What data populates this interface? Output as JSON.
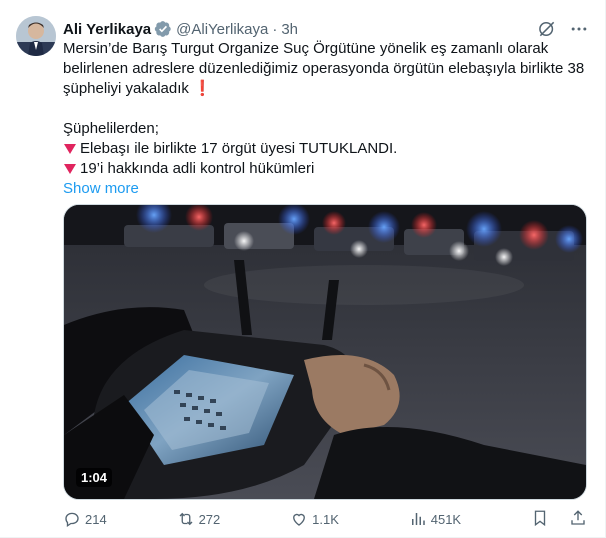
{
  "author": {
    "name": "Ali Yerlikaya",
    "handle": "@AliYerlikaya",
    "time": "3h",
    "separator": "·"
  },
  "tweet": {
    "lines": [
      "Mersin’de Barış Turgut Organize Suç Örgütüne yönelik eş zamanlı olarak",
      "belirlenen adreslere düzenlediğimiz operasyonda örgütün elebaşıyla birlikte 38",
      "şüpheliyi yakaladık"
    ],
    "exclamation": "❗",
    "subheading": "Şüphelilerden;",
    "bullets": [
      "Elebaşı ile birlikte 17 örgüt üyesi TUTUKLANDI.",
      "19’i hakkında adli kontrol hükümleri"
    ],
    "show_more": "Show more"
  },
  "media": {
    "duration": "1:04"
  },
  "actions": {
    "replies": "214",
    "reposts": "272",
    "likes": "1.1K",
    "views": "451K"
  },
  "icons": [
    "verified-badge-icon",
    "grok-icon",
    "more-icon",
    "reply-icon",
    "repost-icon",
    "like-icon",
    "views-icon",
    "bookmark-icon",
    "share-icon"
  ],
  "colors": {
    "accent": "#1d9bf0",
    "text": "#0f1419",
    "muted": "#536471",
    "bullet": "#e0245e"
  }
}
